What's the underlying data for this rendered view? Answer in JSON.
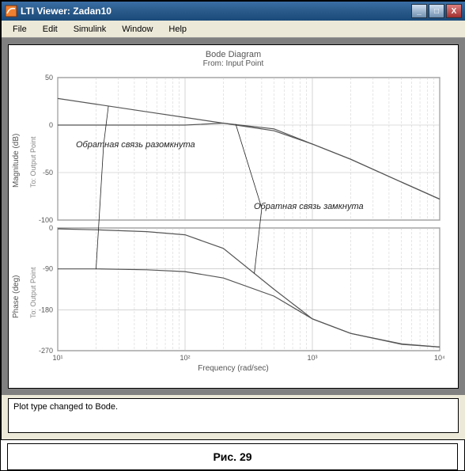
{
  "window": {
    "title": "LTI Viewer: Zadan10",
    "controls": {
      "min": "_",
      "max": "□",
      "close": "X"
    }
  },
  "menubar": {
    "items": [
      "File",
      "Edit",
      "Simulink",
      "Window",
      "Help"
    ]
  },
  "chart": {
    "title": "Bode Diagram",
    "subtitle": "From: Input Point",
    "xlabel": "Frequency (rad/sec)",
    "mag": {
      "ylabel": "Magnitude (dB)",
      "sublabel": "To: Output Point"
    },
    "phase": {
      "ylabel": "Phase (deg)",
      "sublabel": "To: Output Point"
    },
    "annot_open": "Обратная связь разомкнута",
    "annot_closed": "Обратная связь замкнута"
  },
  "status": {
    "message": "Plot type changed to Bode."
  },
  "caption": "Рис. 29",
  "chart_data": {
    "type": "bode",
    "xlabel": "Frequency (rad/sec)",
    "xscale": "log",
    "xlim": [
      10,
      10000
    ],
    "magnitude": {
      "ylabel": "Magnitude (dB)",
      "ylim": [
        -100,
        50
      ],
      "yticks": [
        -100,
        -50,
        0,
        50
      ],
      "series": [
        {
          "name": "Обратная связь разомкнута",
          "x": [
            10,
            20,
            50,
            100,
            200,
            500,
            1000,
            2000,
            5000,
            10000
          ],
          "y": [
            28,
            22,
            14,
            8,
            2,
            -6,
            -20,
            -36,
            -60,
            -78
          ]
        },
        {
          "name": "Обратная связь замкнута",
          "x": [
            10,
            20,
            50,
            100,
            200,
            500,
            1000,
            2000,
            5000,
            10000
          ],
          "y": [
            0,
            0,
            0,
            0,
            2,
            -4,
            -20,
            -36,
            -60,
            -78
          ]
        }
      ]
    },
    "phase": {
      "ylabel": "Phase (deg)",
      "ylim": [
        -270,
        0
      ],
      "yticks": [
        -270,
        -180,
        -90,
        0
      ],
      "series": [
        {
          "name": "Обратная связь разомкнута",
          "x": [
            10,
            20,
            50,
            100,
            200,
            500,
            1000,
            2000,
            5000,
            10000
          ],
          "y": [
            -90,
            -90,
            -92,
            -96,
            -110,
            -150,
            -200,
            -232,
            -255,
            -262
          ]
        },
        {
          "name": "Обратная связь замкнута",
          "x": [
            10,
            20,
            50,
            100,
            200,
            500,
            1000,
            2000,
            5000,
            10000
          ],
          "y": [
            -2,
            -4,
            -8,
            -15,
            -45,
            -135,
            -200,
            -232,
            -256,
            -262
          ]
        }
      ]
    },
    "xticks": [
      10,
      100,
      1000,
      10000
    ],
    "xtick_labels": [
      "10¹",
      "10²",
      "10³",
      "10⁴"
    ]
  }
}
